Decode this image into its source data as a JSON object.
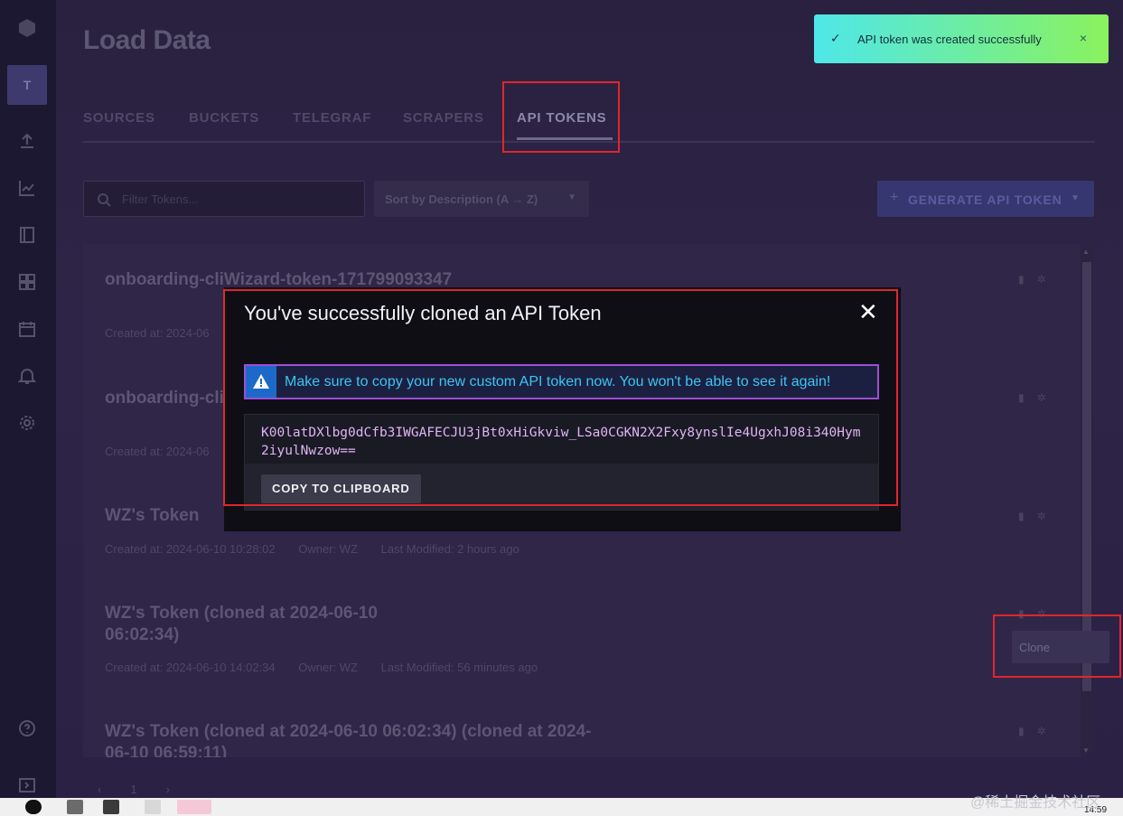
{
  "app": {
    "page_title": "Load Data",
    "org_initial": "T"
  },
  "tabs": [
    {
      "label": "SOURCES"
    },
    {
      "label": "BUCKETS"
    },
    {
      "label": "TELEGRAF"
    },
    {
      "label": "SCRAPERS"
    },
    {
      "label": "API TOKENS",
      "active": true
    }
  ],
  "toolbar": {
    "filter_placeholder": "Filter Tokens...",
    "sort_label": "Sort by Description (A → Z)",
    "generate_label": "GENERATE API TOKEN"
  },
  "tokens": [
    {
      "name": "onboarding-cliWizard-token-171799093347",
      "created": "Created at: 2024-06"
    },
    {
      "name": "onboarding-cliWizard-token-171799112630",
      "created": "Created at: 2024-06"
    },
    {
      "name": "WZ's Token",
      "created": "Created at: 2024-06-10 10:28:02",
      "owner": "Owner: WZ",
      "modified": "Last Modified: 2 hours ago"
    },
    {
      "name": "WZ's Token (cloned at 2024-06-10 06:02:34)",
      "created": "Created at: 2024-06-10 14:02:34",
      "owner": "Owner: WZ",
      "modified": "Last Modified: 56 minutes ago"
    },
    {
      "name": "WZ's Token (cloned at 2024-06-10 06:02:34) (cloned at 2024-06-10 06:59:11)"
    }
  ],
  "context_menu": {
    "clone_label": "Clone"
  },
  "pagination": {
    "prev": "‹",
    "page": "1",
    "next": "›"
  },
  "toast": {
    "message": "API token was created successfully",
    "check": "✓",
    "close": "×",
    "color_start": "#4ee7ea",
    "color_end": "#8af25e"
  },
  "modal": {
    "title": "You've successfully cloned an API Token",
    "close": "✕",
    "warning": "Make sure to copy your new custom API token now. You won't be able to see it again!",
    "token": "K00latDXlbg0dCfb3IWGAFECJU3jBt0xHiGkviw_LSa0CGKN2X2Fxy8ynslIe4UgxhJ08i340Hym2iyulNwzow==",
    "copy_label": "COPY TO CLIPBOARD"
  },
  "taskbar": {
    "time": "14:59"
  },
  "watermark": "@稀土掘金技术社区",
  "colors": {
    "highlight": "#e0262b",
    "warning_border": "#9b4fd6",
    "warning_text": "#39c5f5",
    "token_text": "#e0b3f5"
  }
}
